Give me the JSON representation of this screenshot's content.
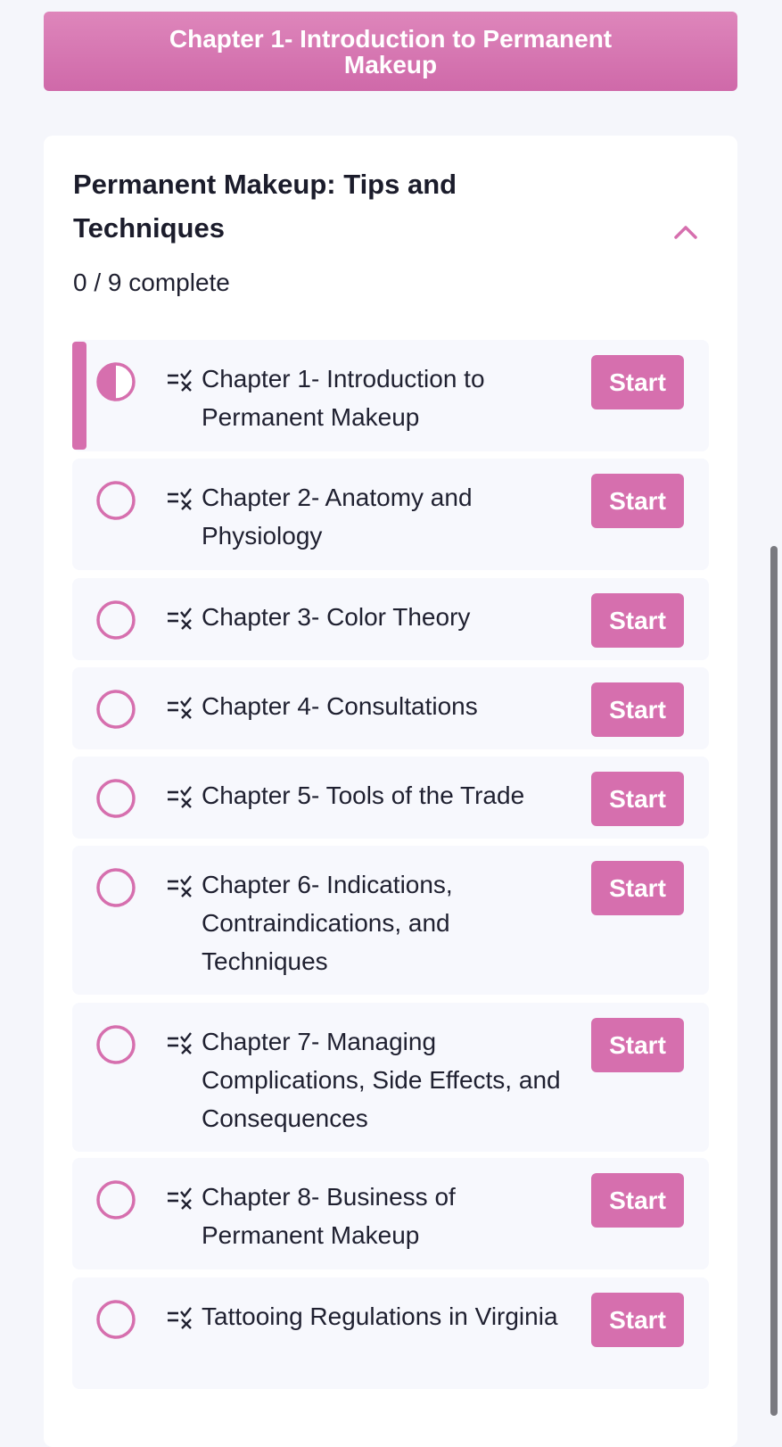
{
  "header": {
    "banner_title": "Chapter 1- Introduction to Permanent Makeup"
  },
  "course": {
    "title": "Permanent Makeup: Tips and Techniques",
    "progress_text": "0 / 9 complete",
    "completed": 0,
    "total": 9,
    "expanded": true,
    "collapse_icon": "chevron-up-icon"
  },
  "lessons": [
    {
      "title": "Chapter 1- Introduction to Permanent Makeup",
      "status": "in-progress",
      "button": "Start",
      "active": true
    },
    {
      "title": "Chapter 2- Anatomy and Physiology",
      "status": "not-started",
      "button": "Start",
      "active": false
    },
    {
      "title": "Chapter 3- Color Theory",
      "status": "not-started",
      "button": "Start",
      "active": false
    },
    {
      "title": "Chapter 4- Consultations",
      "status": "not-started",
      "button": "Start",
      "active": false
    },
    {
      "title": "Chapter 5- Tools of the Trade",
      "status": "not-started",
      "button": "Start",
      "active": false
    },
    {
      "title": "Chapter 6- Indications, Contraindications, and Techniques",
      "status": "not-started",
      "button": "Start",
      "active": false
    },
    {
      "title": "Chapter 7- Managing Complications, Side Effects, and Consequences",
      "status": "not-started",
      "button": "Start",
      "active": false
    },
    {
      "title": "Chapter 8- Business of Permanent Makeup",
      "status": "not-started",
      "button": "Start",
      "active": false
    },
    {
      "title": "Tattooing Regulations in Virginia",
      "status": "not-started",
      "button": "Start",
      "active": false
    }
  ],
  "icons": {
    "lesson_type": "quiz-list-icon",
    "status_in_progress": "half-filled-circle-icon",
    "status_not_started": "empty-circle-icon"
  },
  "colors": {
    "accent": "#d66fae",
    "banner_top": "#de86bb",
    "banner_bottom": "#cf69a9",
    "page_background": "#f5f6fb",
    "row_background": "#f7f8fd",
    "text": "#1f2030"
  }
}
